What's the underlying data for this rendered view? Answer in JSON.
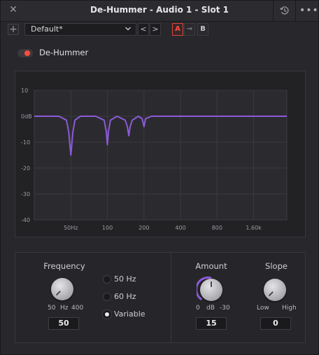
{
  "window": {
    "title": "De-Hummer - Audio 1 -  Slot 1"
  },
  "titlebar": {
    "close_icon": "close-icon",
    "history_icon": "history-icon",
    "more_icon": "more-icon"
  },
  "toolbar": {
    "add_label": "+",
    "preset_value": "Default*",
    "prev_label": "<",
    "next_label": ">",
    "a_label": "A",
    "copy_label": "→",
    "b_label": "B",
    "a_color": "#ff4b3b"
  },
  "effect": {
    "name": "De-Hummer",
    "enabled": true,
    "toggle_color": "#ff4d3d"
  },
  "graph": {
    "y_ticks": [
      "10",
      "0dB",
      "-10",
      "-20",
      "-30",
      "-40"
    ],
    "x_ticks": [
      "50Hz",
      "100",
      "200",
      "400",
      "800",
      "1.60k"
    ],
    "curve_color": "#8c5ad8",
    "grid_color": "#3a3a3f"
  },
  "chart_data": {
    "type": "line",
    "title": "",
    "xlabel": "",
    "ylabel": "",
    "x_scale": "log",
    "ylim": [
      -40,
      10
    ],
    "x": [
      25,
      40,
      46,
      48,
      50,
      52,
      54,
      60,
      80,
      94,
      98,
      100,
      102,
      106,
      120,
      140,
      146,
      150,
      154,
      160,
      180,
      193,
      198,
      200,
      202,
      206,
      230,
      400,
      800,
      1600,
      3000
    ],
    "series": [
      {
        "values": [
          0,
          0,
          -1.5,
          -6,
          -15,
          -6,
          -1.5,
          0,
          0,
          -1.5,
          -6,
          -11,
          -6,
          -1.5,
          0,
          -1.5,
          -4,
          -7.5,
          -4,
          -1.5,
          0,
          -1,
          -3,
          -4,
          -3,
          -1,
          0,
          0,
          0,
          0,
          0
        ]
      }
    ]
  },
  "frequency": {
    "label": "Frequency",
    "min_label": "50",
    "unit_label": "Hz",
    "max_label": "400",
    "value": "50",
    "options": [
      {
        "label": "50 Hz",
        "selected": false
      },
      {
        "label": "60 Hz",
        "selected": false
      },
      {
        "label": "Variable",
        "selected": true
      }
    ]
  },
  "amount": {
    "label": "Amount",
    "min_label": "0",
    "unit_label": "dB",
    "max_label": "-30",
    "value": "15",
    "arc_color": "#8c5ad8"
  },
  "slope": {
    "label": "Slope",
    "min_label": "Low",
    "max_label": "High",
    "value": "0"
  }
}
